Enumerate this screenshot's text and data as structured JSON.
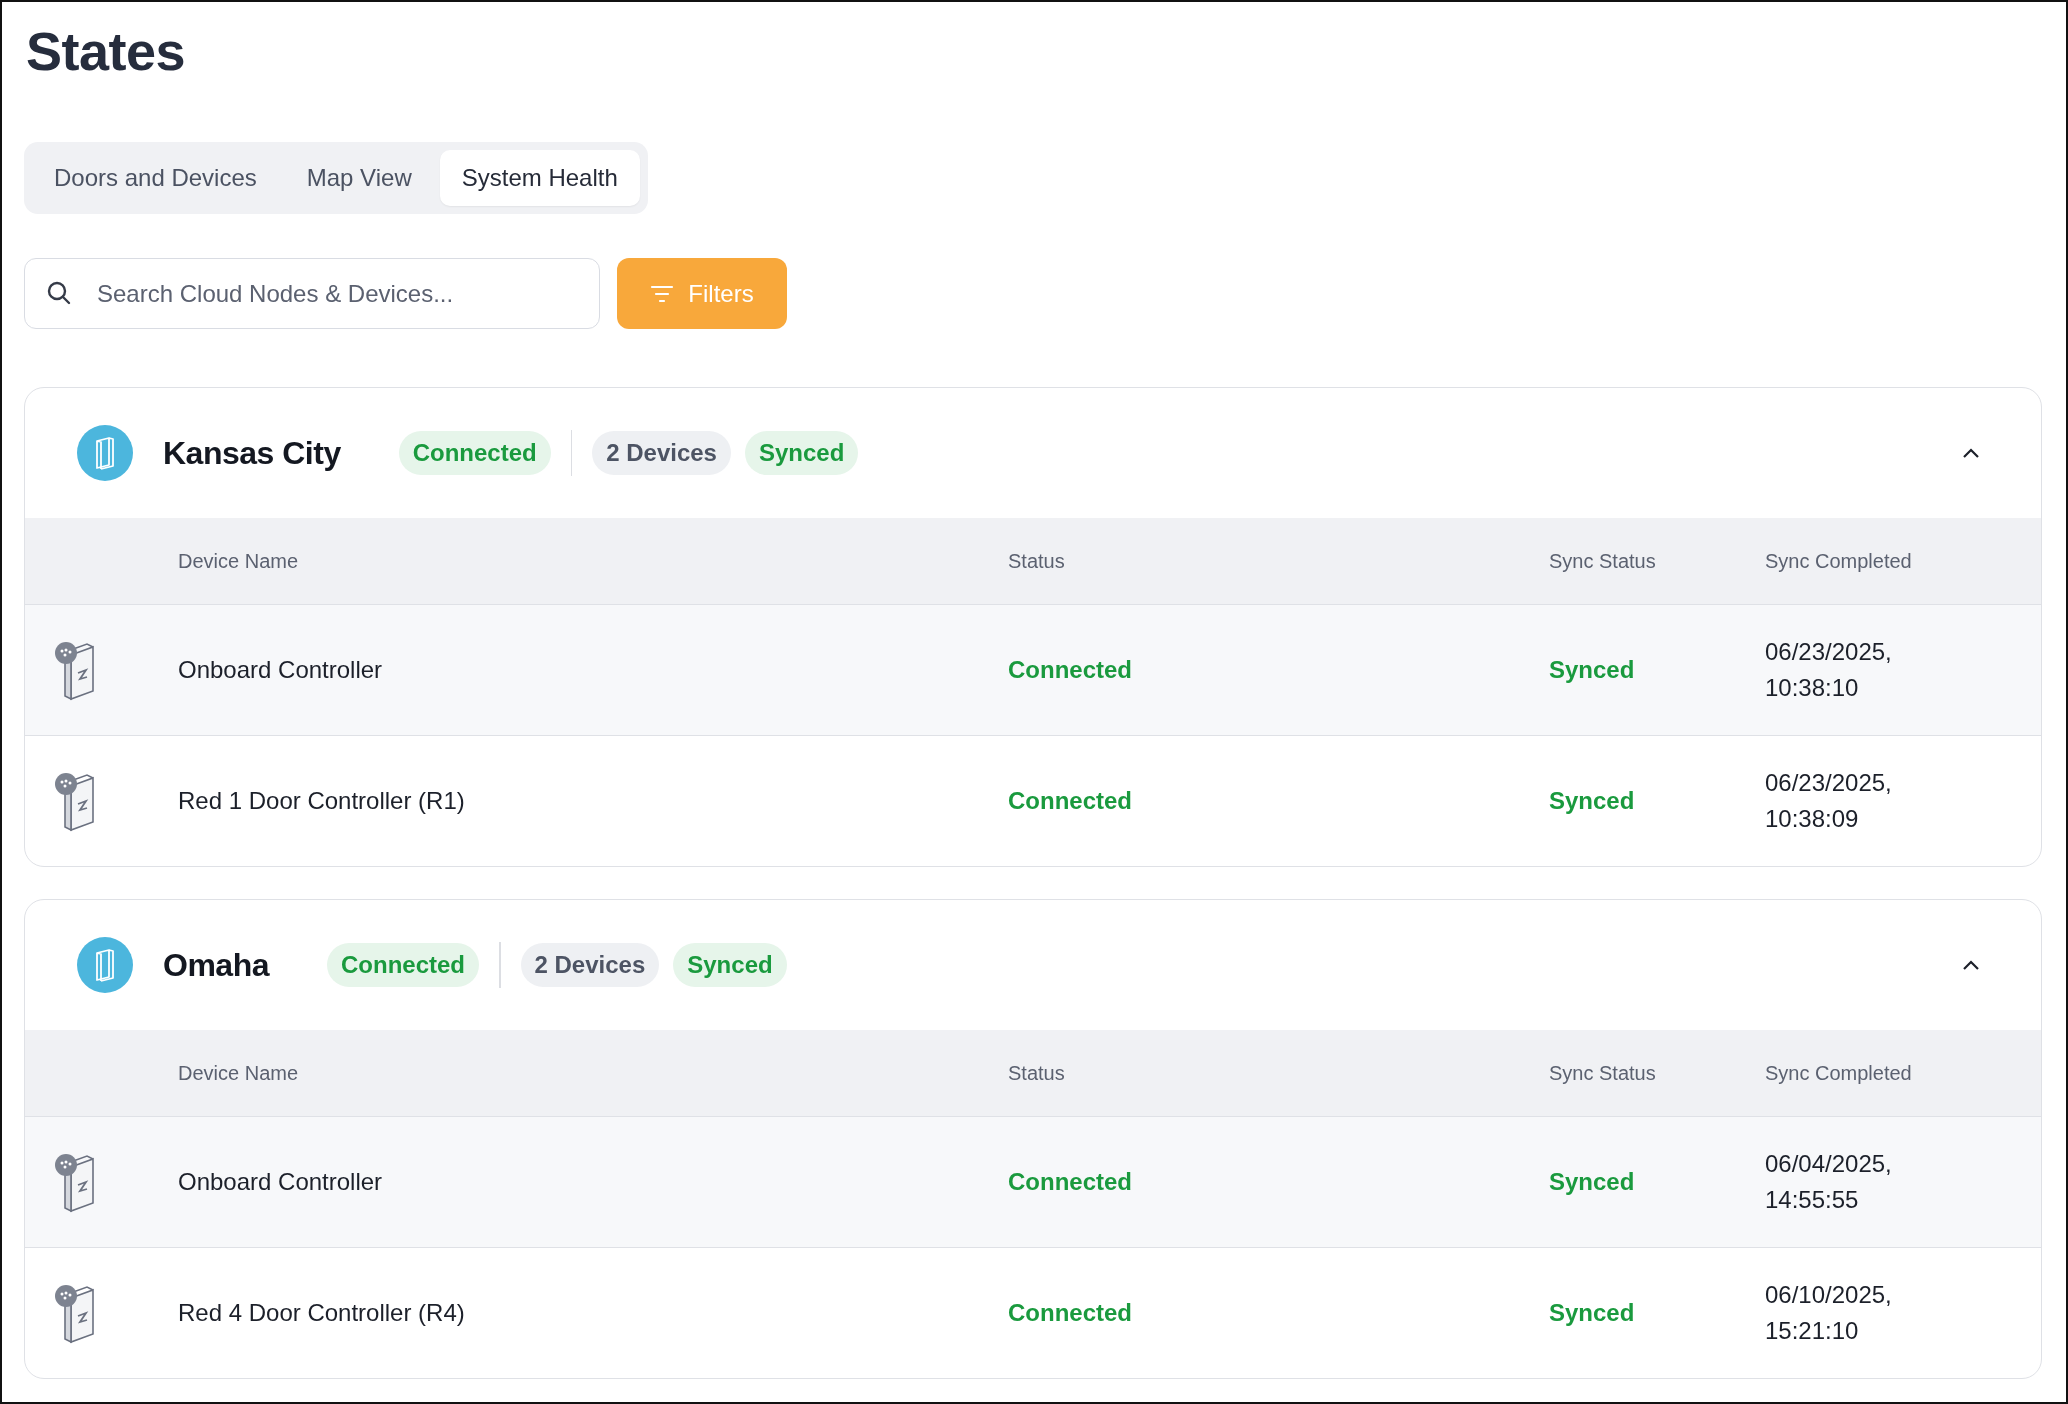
{
  "title": "States",
  "tabs": [
    {
      "label": "Doors and Devices",
      "selected": false
    },
    {
      "label": "Map View",
      "selected": false
    },
    {
      "label": "System Health",
      "selected": true
    }
  ],
  "search": {
    "placeholder": "Search Cloud Nodes & Devices..."
  },
  "filters_button": "Filters",
  "nodes": [
    {
      "name": "Kansas City",
      "status": "Connected",
      "device_count": "2 Devices",
      "sync": "Synced",
      "expanded": true,
      "columns": [
        "Device Name",
        "Status",
        "Sync Status",
        "Sync Completed"
      ],
      "rows": [
        {
          "name": "Onboard Controller",
          "status": "Connected",
          "sync_status": "Synced",
          "sync_completed": "06/23/2025, 10:38:10"
        },
        {
          "name": "Red 1 Door Controller (R1)",
          "status": "Connected",
          "sync_status": "Synced",
          "sync_completed": "06/23/2025, 10:38:09"
        }
      ]
    },
    {
      "name": "Omaha",
      "status": "Connected",
      "device_count": "2 Devices",
      "sync": "Synced",
      "expanded": true,
      "columns": [
        "Device Name",
        "Status",
        "Sync Status",
        "Sync Completed"
      ],
      "rows": [
        {
          "name": "Onboard Controller",
          "status": "Connected",
          "sync_status": "Synced",
          "sync_completed": "06/04/2025, 14:55:55"
        },
        {
          "name": "Red 4 Door Controller (R4)",
          "status": "Connected",
          "sync_status": "Synced",
          "sync_completed": "06/10/2025, 15:21:10"
        }
      ]
    }
  ]
}
